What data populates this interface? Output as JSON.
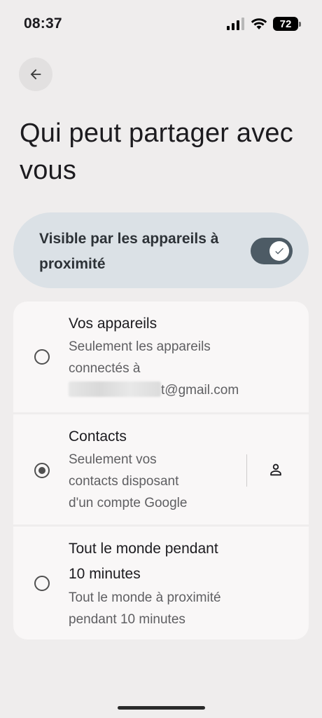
{
  "status": {
    "time": "08:37",
    "battery": "72",
    "icons": [
      "signal-icon",
      "wifi-icon",
      "battery-icon"
    ]
  },
  "header": {
    "back_icon": "arrow-back-icon",
    "title": "Qui peut partager avec vous"
  },
  "visibility": {
    "label": "Visible par les appareils à proximité",
    "enabled": true
  },
  "options": [
    {
      "title": "Vos appareils",
      "desc_line1": "Seulement les appareils",
      "desc_line2": "connectés à",
      "email_suffix": "t@gmail.com",
      "selected": false
    },
    {
      "title": "Contacts",
      "desc_line1": "Seulement vos",
      "desc_line2": "contacts disposant",
      "desc_line3": "d'un compte Google",
      "selected": true,
      "action_icon": "person-icon"
    },
    {
      "title_line1": "Tout le monde pendant",
      "title_line2": "10 minutes",
      "desc_line1": "Tout le monde à proximité",
      "desc_line2": "pendant 10 minutes",
      "selected": false
    }
  ],
  "colors": {
    "background": "#efeded",
    "card": "#f9f7f7",
    "visibility_card": "#dbe1e6",
    "toggle_on": "#4d5b65"
  }
}
